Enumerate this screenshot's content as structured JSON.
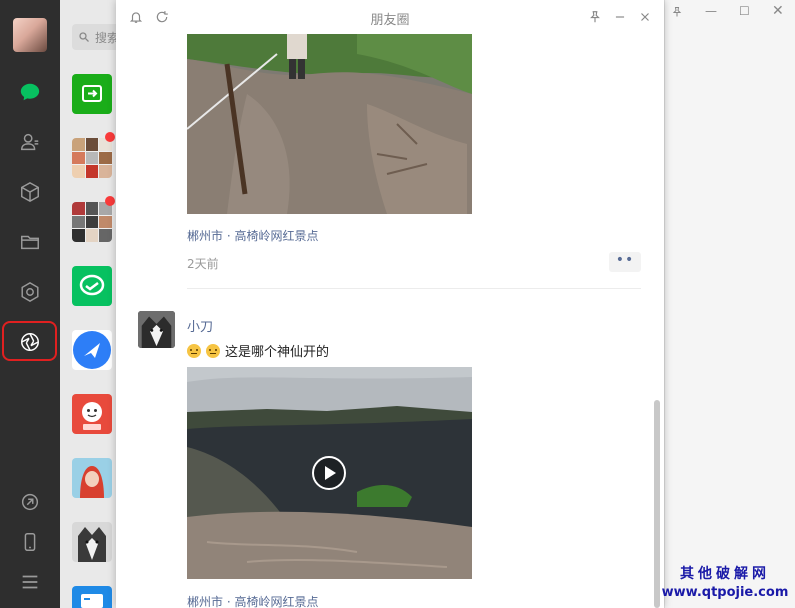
{
  "nav": {
    "items": [
      {
        "name": "chat",
        "icon": "chat-bubble-icon",
        "active": true
      },
      {
        "name": "contacts",
        "icon": "contacts-icon"
      },
      {
        "name": "favorites",
        "icon": "cube-icon"
      },
      {
        "name": "files",
        "icon": "folder-icon"
      },
      {
        "name": "mini-programs",
        "icon": "hexagon-icon"
      },
      {
        "name": "moments",
        "icon": "aperture-icon",
        "highlighted": true
      }
    ],
    "bottom": [
      {
        "name": "mini-program-link",
        "icon": "link-icon"
      },
      {
        "name": "phone",
        "icon": "phone-icon"
      },
      {
        "name": "menu",
        "icon": "menu-icon"
      }
    ]
  },
  "list": {
    "search_placeholder": "搜索"
  },
  "moments": {
    "title": "朋友圈",
    "post1": {
      "location": "郴州市 · 高椅岭网红景点",
      "time": "2天前",
      "more": "••"
    },
    "post2": {
      "name": "小刀",
      "text": "这是哪个神仙开的",
      "location": "郴州市 · 高椅岭网红景点"
    }
  },
  "watermark": {
    "line1": "其他破解网",
    "line2": "www.qtpojie.com"
  },
  "colors": {
    "nav_bg": "#2e2e2e",
    "link_blue": "#576b95",
    "wechat_green": "#07c160",
    "highlight_red": "#e02020"
  }
}
